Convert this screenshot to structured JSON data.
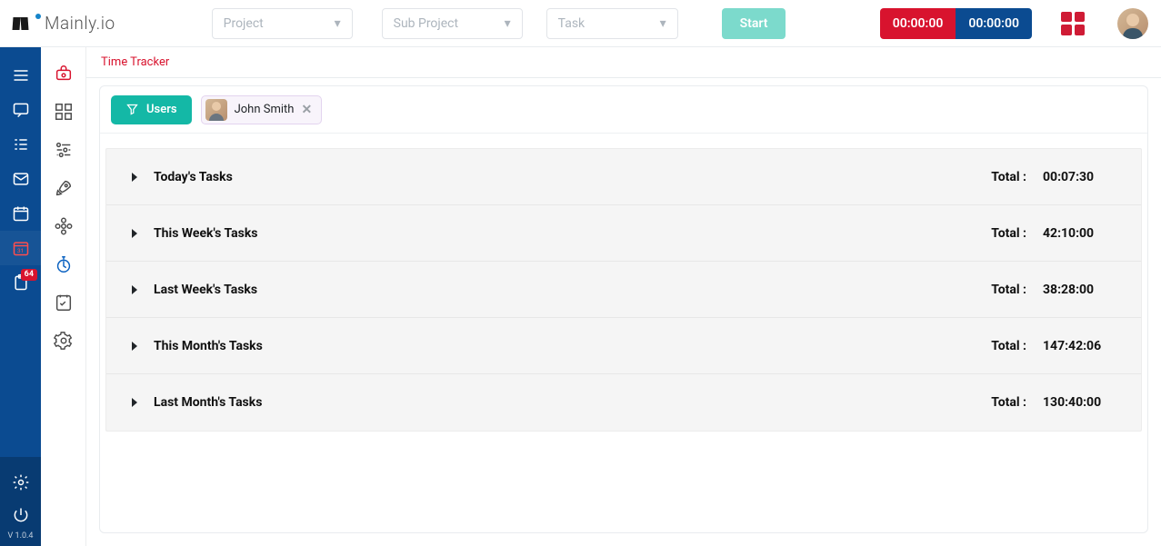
{
  "brand": "Mainly.io",
  "selectors": {
    "project": "Project",
    "subproject": "Sub Project",
    "task": "Task"
  },
  "start_label": "Start",
  "timer_red": "00:00:00",
  "timer_blue": "00:00:00",
  "left_rail": {
    "badge": "64",
    "version": "V 1.0.4"
  },
  "page_title": "Time Tracker",
  "filter": {
    "users_btn": "Users",
    "chip_name": "John Smith"
  },
  "total_label": "Total :",
  "groups": [
    {
      "title": "Today's Tasks",
      "total": "00:07:30"
    },
    {
      "title": "This Week's Tasks",
      "total": "42:10:00"
    },
    {
      "title": "Last Week's Tasks",
      "total": "38:28:00"
    },
    {
      "title": "This Month's Tasks",
      "total": "147:42:06"
    },
    {
      "title": "Last Month's Tasks",
      "total": "130:40:00"
    }
  ]
}
